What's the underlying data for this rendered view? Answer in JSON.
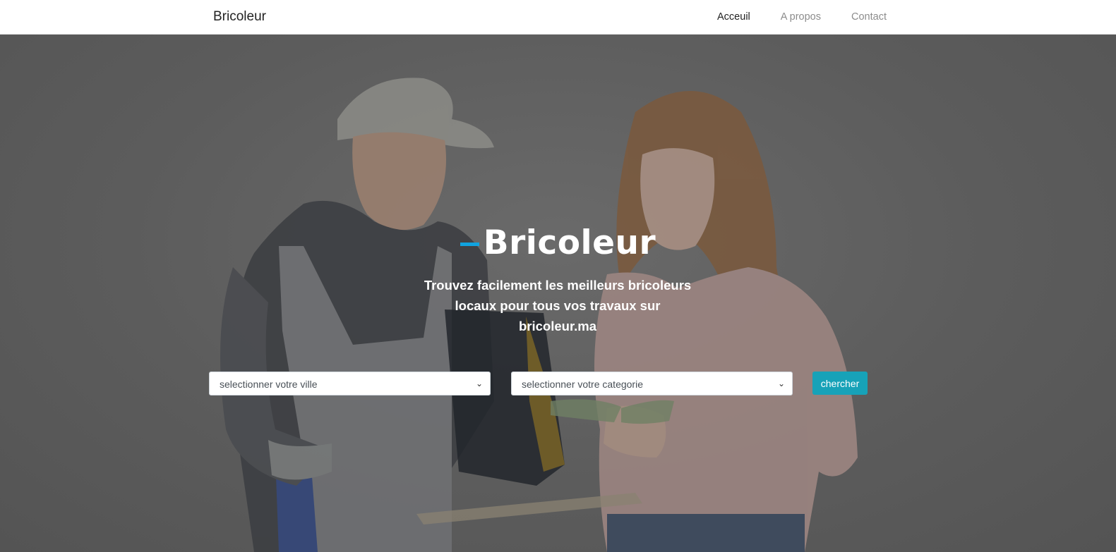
{
  "navbar": {
    "brand": "Bricoleur",
    "links": [
      {
        "label": "Acceuil",
        "active": true
      },
      {
        "label": "A propos",
        "active": false
      },
      {
        "label": "Contact",
        "active": false
      }
    ]
  },
  "hero": {
    "title": "Bricoleur",
    "tagline": "Trouvez facilement les meilleurs bricoleurs locaux pour tous vos travaux sur bricoleur.ma",
    "accent_color": "#11a3df"
  },
  "search": {
    "ville_select": "selectionner votre ville",
    "categorie_select": "selectionner votre categorie",
    "button": "chercher",
    "button_color": "#17a2b8"
  },
  "icons": {
    "dropdown": "chevron-down-icon"
  }
}
